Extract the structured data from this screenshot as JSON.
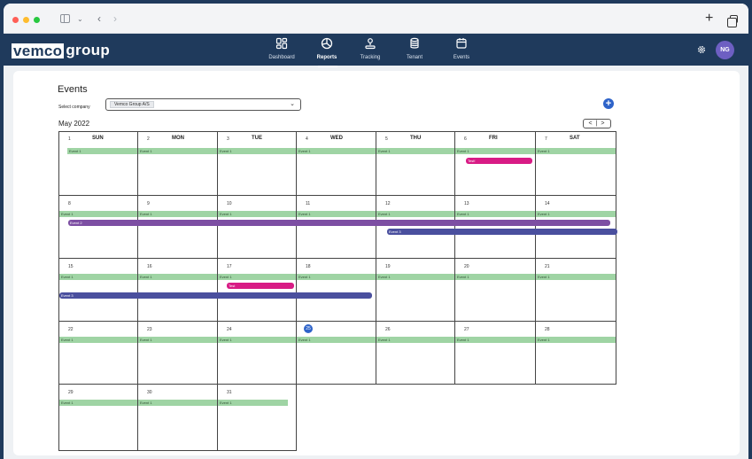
{
  "app": {
    "logo_box": "vemco",
    "logo_rest": "group"
  },
  "nav": [
    {
      "label": "Dashboard",
      "icon": "dashboard-icon"
    },
    {
      "label": "Reports",
      "icon": "reports-icon",
      "active": true
    },
    {
      "label": "Tracking",
      "icon": "tracking-icon"
    },
    {
      "label": "Tenant",
      "icon": "tenant-icon"
    },
    {
      "label": "Events",
      "icon": "events-icon"
    }
  ],
  "user": {
    "initials": "NG"
  },
  "page": {
    "title": "Events",
    "company_label": "Select company",
    "company_value": "Vemco Group A/S",
    "month": "May 2022",
    "nav_arrows": "< | >"
  },
  "calendar": {
    "weekdays": [
      "SUN",
      "MON",
      "TUE",
      "WED",
      "THU",
      "FRI",
      "SAT"
    ],
    "weeks": [
      [
        "1",
        "2",
        "3",
        "4",
        "5",
        "6",
        "7"
      ],
      [
        "8",
        "9",
        "10",
        "11",
        "12",
        "13",
        "14"
      ],
      [
        "15",
        "16",
        "17",
        "18",
        "19",
        "20",
        "21"
      ],
      [
        "22",
        "23",
        "24",
        "25",
        "26",
        "27",
        "28"
      ],
      [
        "29",
        "30",
        "31"
      ]
    ],
    "today": "25",
    "event_names": {
      "event1": "Event 1",
      "event2": "Event 2",
      "event3": "Event 3",
      "test": "Test",
      "test_exclaim": "Test!"
    }
  },
  "colors": {
    "navy": "#1f3a5c",
    "green": "#9fd4a4",
    "purple": "#7d4fa3",
    "indigo": "#4a4f9e",
    "pink": "#d81b85",
    "accent": "#2e63c9"
  }
}
